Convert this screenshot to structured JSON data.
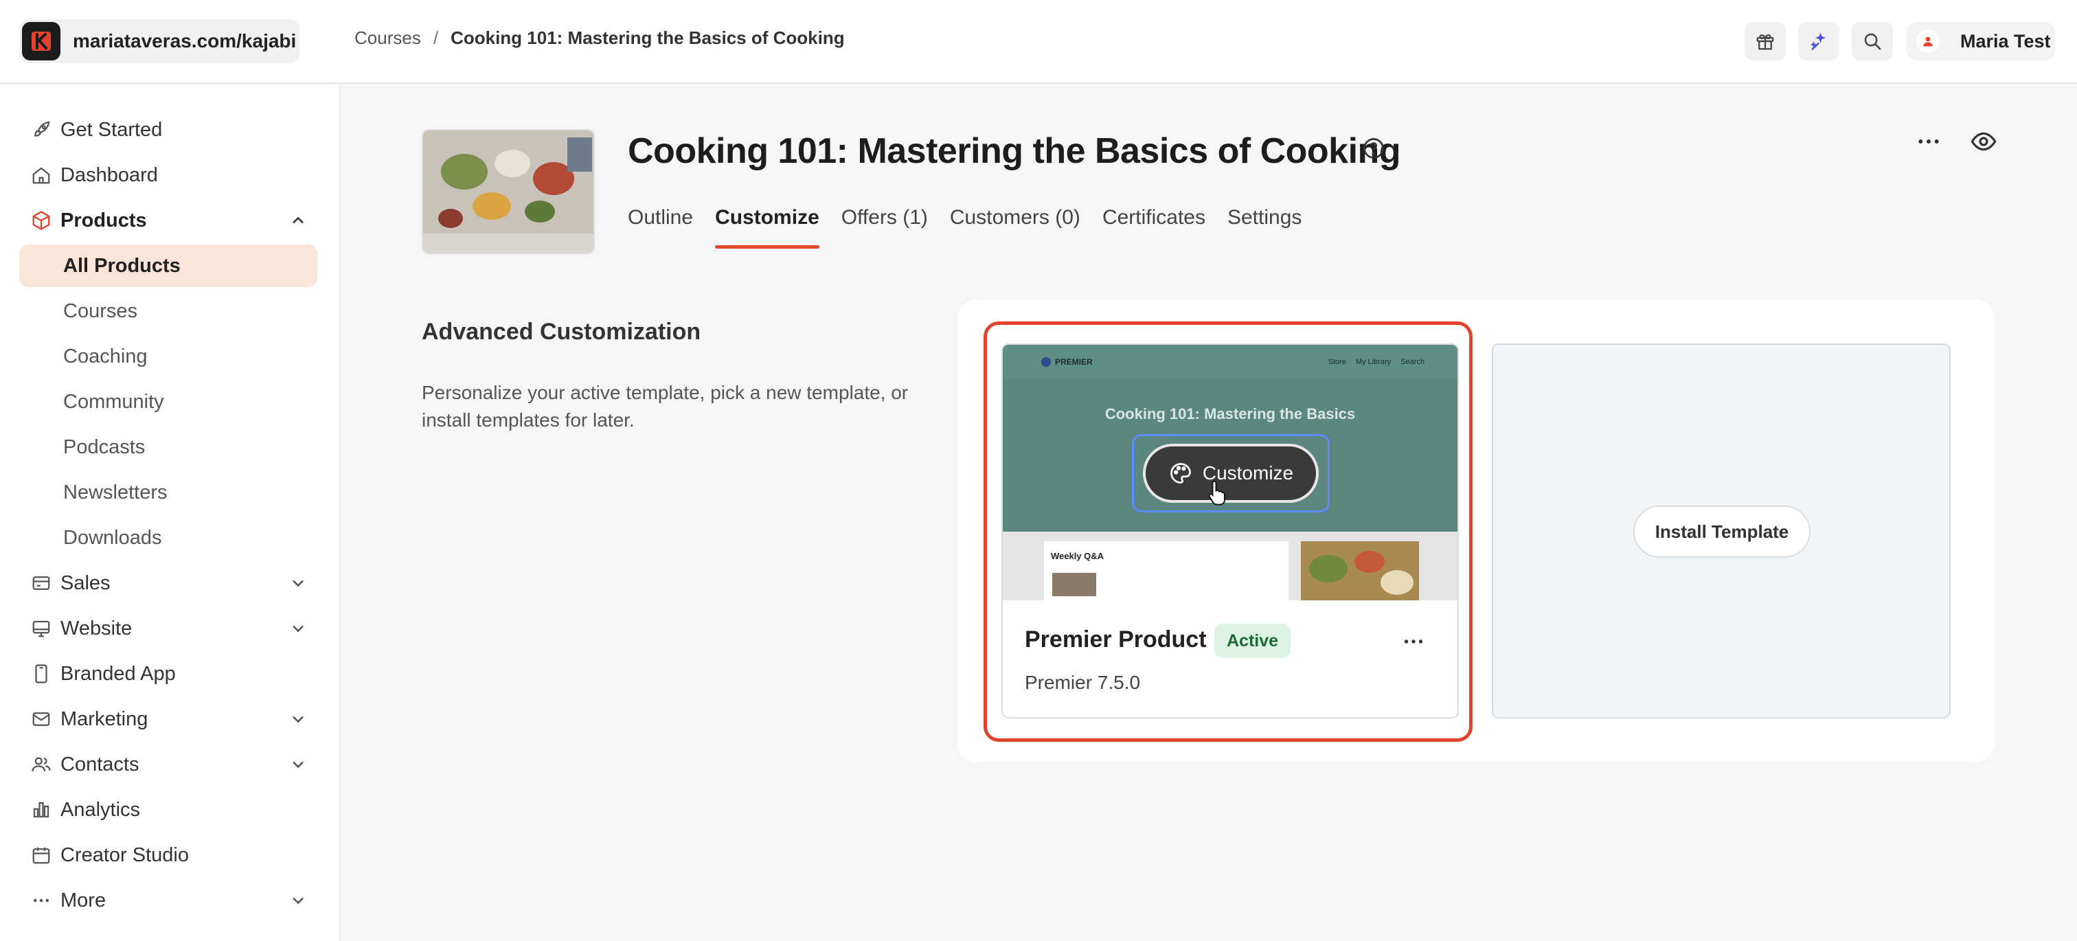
{
  "colors": {
    "accent": "#e04b2b",
    "active_bg": "#fbe4d8",
    "badge_bg": "#dff3e4",
    "badge_text": "#1d6b34",
    "focus": "#5b8cff",
    "preview_teal": "#5c8781"
  },
  "header": {
    "site": "mariataveras.com/kajabi",
    "breadcrumb": {
      "root": "Courses",
      "separator": "/",
      "current": "Cooking 101: Mastering the Basics of Cooking"
    },
    "icons": [
      "gift-icon",
      "sparkle-icon",
      "search-icon"
    ],
    "user": {
      "name": "Maria Test"
    }
  },
  "sidebar": {
    "items": [
      {
        "label": "Get Started",
        "icon": "rocket-icon"
      },
      {
        "label": "Dashboard",
        "icon": "home-icon"
      },
      {
        "label": "Products",
        "icon": "box-icon",
        "expanded": true
      },
      {
        "label": "All Products",
        "active": true
      },
      {
        "label": "Courses"
      },
      {
        "label": "Coaching"
      },
      {
        "label": "Community"
      },
      {
        "label": "Podcasts"
      },
      {
        "label": "Newsletters"
      },
      {
        "label": "Downloads"
      },
      {
        "label": "Sales",
        "icon": "card-icon"
      },
      {
        "label": "Website",
        "icon": "monitor-icon"
      },
      {
        "label": "Branded App",
        "icon": "phone-icon"
      },
      {
        "label": "Marketing",
        "icon": "mail-icon"
      },
      {
        "label": "Contacts",
        "icon": "people-icon"
      },
      {
        "label": "Analytics",
        "icon": "chart-icon"
      },
      {
        "label": "Creator Studio",
        "icon": "calendar-icon"
      },
      {
        "label": "More",
        "icon": "dots-icon"
      }
    ]
  },
  "main": {
    "title": "Cooking 101: Mastering the Basics of Cooking",
    "tabs": [
      {
        "label": "Outline"
      },
      {
        "label": "Customize",
        "active": true
      },
      {
        "label": "Offers (1)"
      },
      {
        "label": "Customers (0)"
      },
      {
        "label": "Certificates"
      },
      {
        "label": "Settings"
      }
    ],
    "section": {
      "title": "Advanced Customization",
      "description": "Personalize your active template, pick a new template, or install templates for later."
    },
    "theme": {
      "preview_brand": "PREMIER",
      "preview_nav": [
        "Store",
        "My Library",
        "Search"
      ],
      "preview_title": "Cooking 101: Mastering the Basics",
      "preview_section": "Weekly Q&A",
      "customize_label": "Customize",
      "name": "Premier Product",
      "status": "Active",
      "version": "Premier 7.5.0"
    },
    "install_label": "Install Template"
  }
}
